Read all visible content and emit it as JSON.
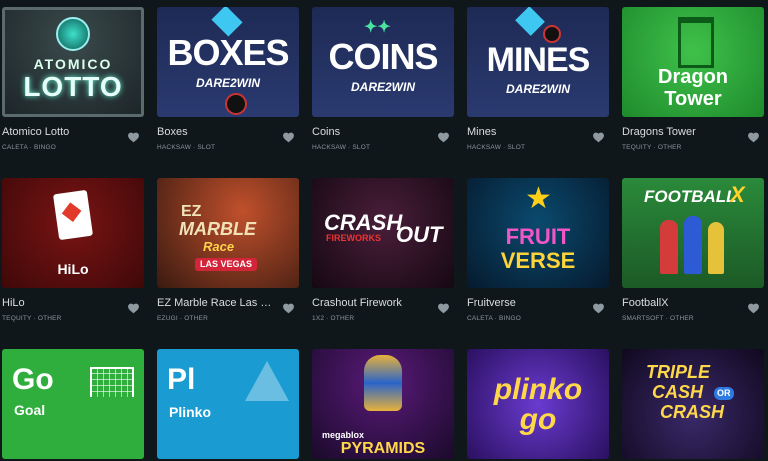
{
  "games": [
    {
      "name": "Atomico Lotto",
      "provider": "CALETA · BINGO",
      "art": [
        "ATOMICO",
        "LOTTO"
      ]
    },
    {
      "name": "Boxes",
      "provider": "HACKSAW · SLOT",
      "art": [
        "BOXES",
        "DARE2WIN"
      ]
    },
    {
      "name": "Coins",
      "provider": "HACKSAW · SLOT",
      "art": [
        "COINS",
        "DARE2WIN"
      ]
    },
    {
      "name": "Mines",
      "provider": "HACKSAW · SLOT",
      "art": [
        "MINES",
        "DARE2WIN"
      ]
    },
    {
      "name": "Dragons Tower",
      "provider": "TEQUITY · OTHER",
      "art": [
        "Dragon",
        "Tower"
      ]
    },
    {
      "name": "HiLo",
      "provider": "TEQUITY · OTHER",
      "art": [
        "HiLo"
      ]
    },
    {
      "name": "EZ Marble Race Las Vegas",
      "provider": "EZUGI · OTHER",
      "art": [
        "EZ",
        "MARBLE",
        "Race",
        "LAS VEGAS"
      ]
    },
    {
      "name": "Crashout Firework",
      "provider": "1X2 · OTHER",
      "art": [
        "CRASH",
        "OUT",
        "FIREWORKS"
      ]
    },
    {
      "name": "Fruitverse",
      "provider": "CALETA · BINGO",
      "art": [
        "FRUIT",
        "VERSE"
      ]
    },
    {
      "name": "FootballX",
      "provider": "SMARTSOFT · OTHER",
      "art": [
        "FOOTBALL",
        "X"
      ]
    },
    {
      "name": "Go Goal",
      "provider": "",
      "art": [
        "Go",
        "Goal"
      ]
    },
    {
      "name": "Plinko",
      "provider": "",
      "art": [
        "Pl",
        "Plinko"
      ]
    },
    {
      "name": "Megablox Pyramids",
      "provider": "",
      "art": [
        "megablox",
        "PYRAMIDS"
      ]
    },
    {
      "name": "Plinko Go",
      "provider": "",
      "art": [
        "plinko",
        "go"
      ]
    },
    {
      "name": "Triple Cash or Crash",
      "provider": "",
      "art": [
        "TRIPLE",
        "CASH",
        "OR",
        "CRASH"
      ]
    }
  ],
  "colors": {
    "background": "#0f171b",
    "heart": "#8f9aa0"
  },
  "icons": {
    "favorite": "heart-icon"
  }
}
